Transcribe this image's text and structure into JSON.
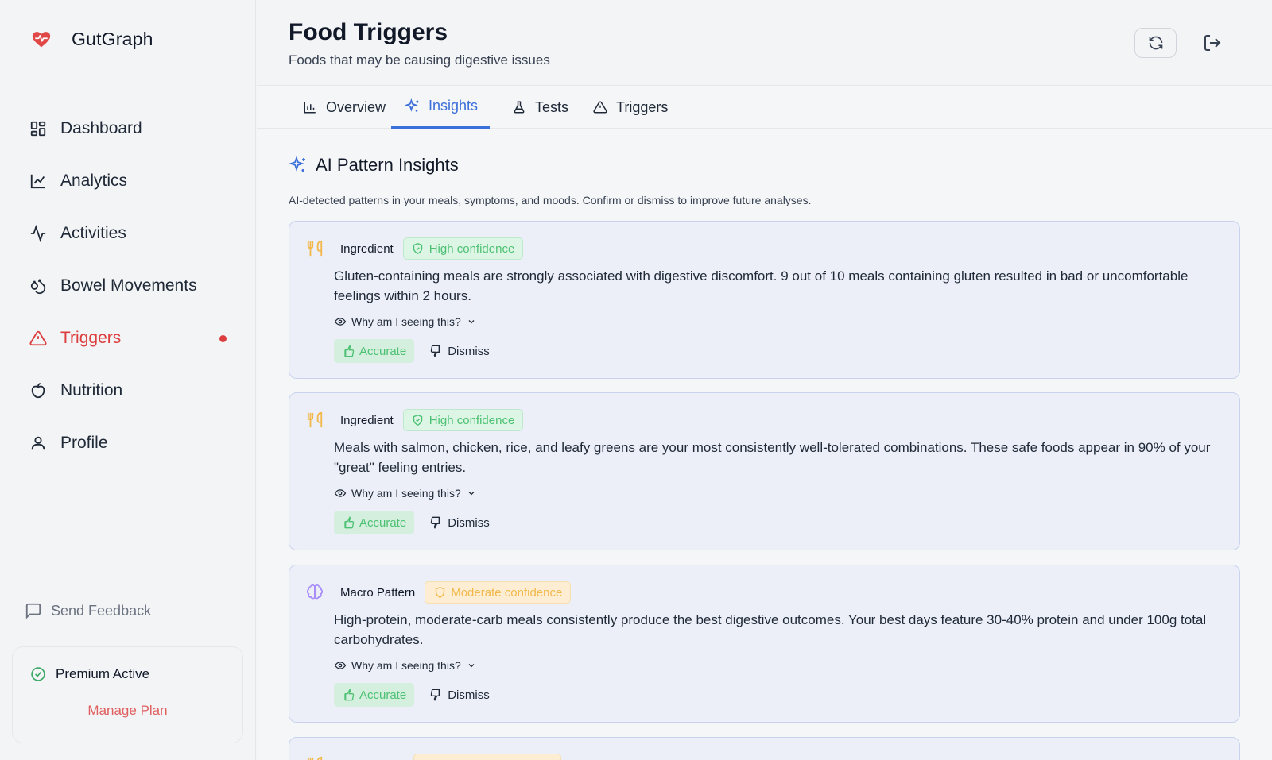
{
  "app": {
    "name": "GutGraph"
  },
  "sidebar": {
    "items": [
      {
        "label": "Dashboard"
      },
      {
        "label": "Analytics"
      },
      {
        "label": "Activities"
      },
      {
        "label": "Bowel Movements"
      },
      {
        "label": "Triggers"
      },
      {
        "label": "Nutrition"
      },
      {
        "label": "Profile"
      }
    ],
    "feedback_label": "Send Feedback",
    "premium": {
      "status": "Premium Active",
      "manage_label": "Manage Plan"
    }
  },
  "header": {
    "title": "Food Triggers",
    "subtitle": "Foods that may be causing digestive issues"
  },
  "tabs": [
    {
      "label": "Overview"
    },
    {
      "label": "Insights"
    },
    {
      "label": "Tests"
    },
    {
      "label": "Triggers"
    }
  ],
  "insights": {
    "title": "AI Pattern Insights",
    "description": "AI-detected patterns in your meals, symptoms, and moods. Confirm or dismiss to improve future analyses.",
    "why_label": "Why am I seeing this?",
    "accurate_label": "Accurate",
    "dismiss_label": "Dismiss",
    "cards": [
      {
        "category": "Ingredient",
        "confidence": "High confidence",
        "text": "Gluten-containing meals are strongly associated with digestive discomfort. 9 out of 10 meals containing gluten resulted in bad or uncomfortable feelings within 2 hours."
      },
      {
        "category": "Ingredient",
        "confidence": "High confidence",
        "text": "Meals with salmon, chicken, rice, and leafy greens are your most consistently well-tolerated combinations. These safe foods appear in 90% of your \"great\" feeling entries."
      },
      {
        "category": "Macro Pattern",
        "confidence": "Moderate confidence",
        "text": "High-protein, moderate-carb meals consistently produce the best digestive outcomes. Your best days feature 30-40% protein and under 100g total carbohydrates."
      }
    ]
  },
  "colors": {
    "accent": "#3b6fd9",
    "danger": "#dc3d3d",
    "high": "#4cc173",
    "moderate": "#f2b84b"
  }
}
